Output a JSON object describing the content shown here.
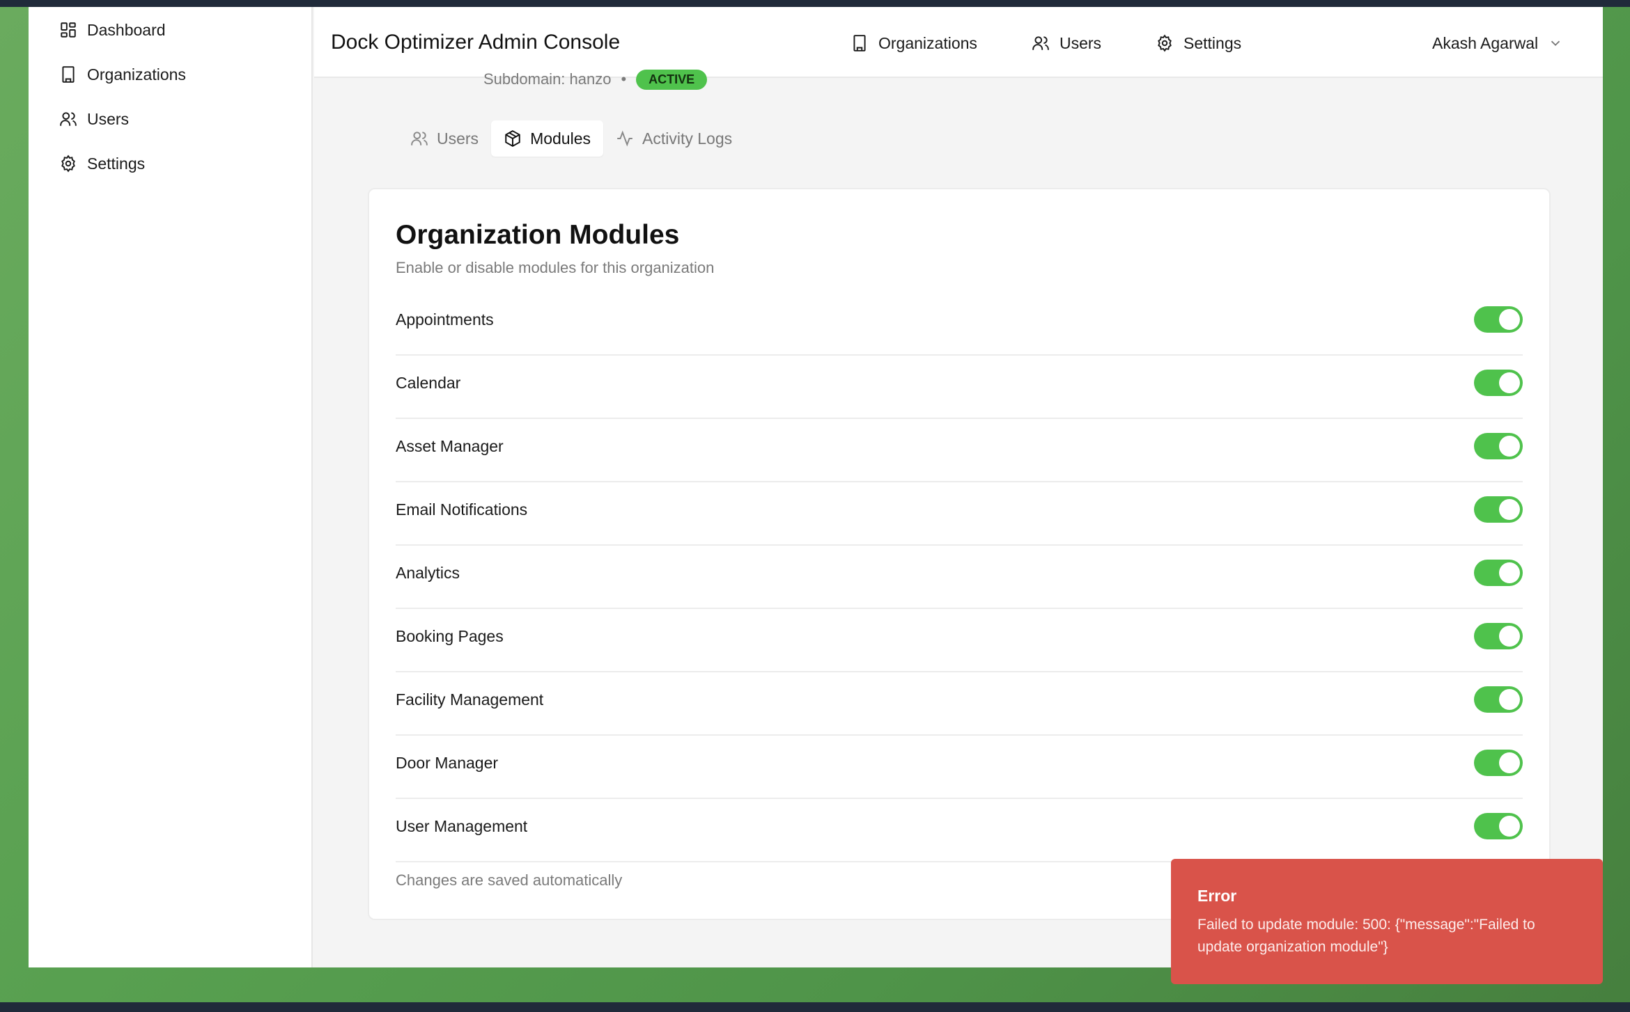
{
  "app": {
    "title": "Dock Optimizer Admin Console"
  },
  "sidebar": {
    "items": [
      {
        "label": "Dashboard",
        "icon": "dashboard-icon"
      },
      {
        "label": "Organizations",
        "icon": "building-icon"
      },
      {
        "label": "Users",
        "icon": "users-icon"
      },
      {
        "label": "Settings",
        "icon": "gear-icon"
      }
    ]
  },
  "header": {
    "nav": [
      {
        "label": "Organizations",
        "icon": "building-icon"
      },
      {
        "label": "Users",
        "icon": "users-icon"
      },
      {
        "label": "Settings",
        "icon": "gear-icon"
      }
    ],
    "user_name": "Akash Agarwal"
  },
  "org": {
    "subdomain_text": "Subdomain: hanzo",
    "separator": "•",
    "status": "ACTIVE"
  },
  "tabs": [
    {
      "label": "Users",
      "icon": "users-icon",
      "active": false
    },
    {
      "label": "Modules",
      "icon": "package-icon",
      "active": true
    },
    {
      "label": "Activity Logs",
      "icon": "activity-icon",
      "active": false
    }
  ],
  "modules_card": {
    "title": "Organization Modules",
    "subtitle": "Enable or disable modules for this organization",
    "modules": [
      {
        "label": "Appointments",
        "enabled": true
      },
      {
        "label": "Calendar",
        "enabled": true
      },
      {
        "label": "Asset Manager",
        "enabled": true
      },
      {
        "label": "Email Notifications",
        "enabled": true
      },
      {
        "label": "Analytics",
        "enabled": true
      },
      {
        "label": "Booking Pages",
        "enabled": true
      },
      {
        "label": "Facility Management",
        "enabled": true
      },
      {
        "label": "Door Manager",
        "enabled": true
      },
      {
        "label": "User Management",
        "enabled": true
      }
    ],
    "footer": "Changes are saved automatically"
  },
  "toast": {
    "title": "Error",
    "message": "Failed to update module: 500: {\"message\":\"Failed to update organization module\"}"
  },
  "colors": {
    "accent_green": "#4fc24c",
    "error_red": "#d9534a"
  }
}
